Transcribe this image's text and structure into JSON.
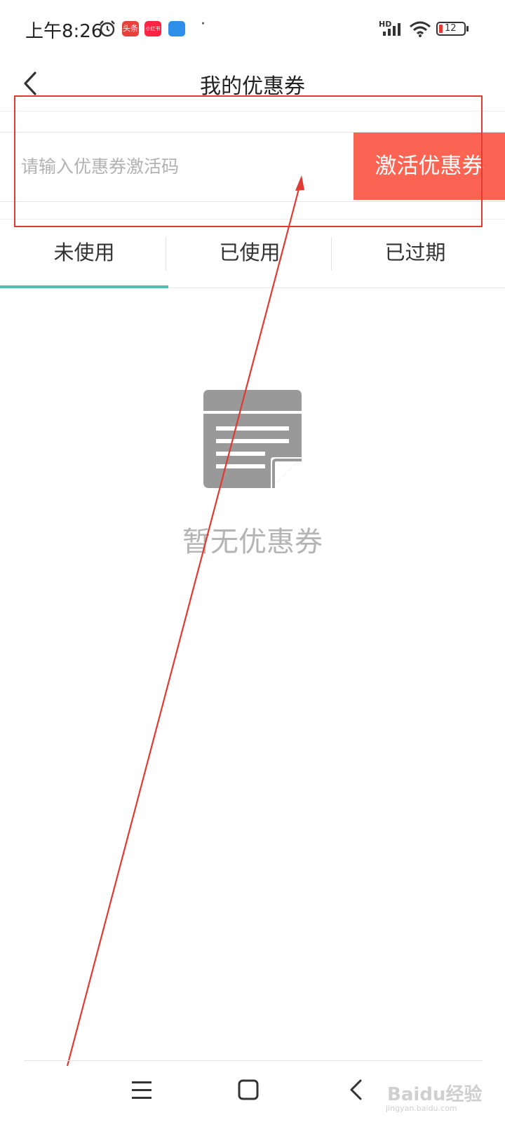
{
  "status_bar": {
    "time": "上午8:26",
    "notification_apps": [
      "头条",
      "小红书",
      "天气"
    ],
    "network_label": "HD",
    "battery_level": "12"
  },
  "header": {
    "title": "我的优惠券"
  },
  "activation": {
    "placeholder": "请输入优惠券激活码",
    "button_label": "激活优惠券"
  },
  "tabs": [
    {
      "label": "未使用",
      "active": true
    },
    {
      "label": "已使用",
      "active": false
    },
    {
      "label": "已过期",
      "active": false
    }
  ],
  "empty_state": {
    "text": "暂无优惠券",
    "icon": "document-icon"
  },
  "watermark": {
    "main": "Baidu经验",
    "sub": "jingyan.baidu.com"
  },
  "colors": {
    "accent_tab": "#4fc1b4",
    "activate_button": "#fb6452",
    "annotation": "#e03a32"
  }
}
